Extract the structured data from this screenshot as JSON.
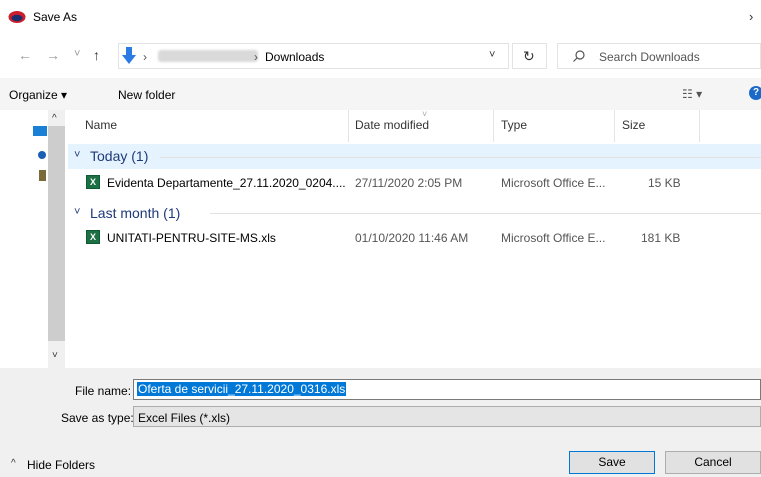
{
  "window": {
    "title": "Save As",
    "close_glyph": "›"
  },
  "address": {
    "back_glyph": "←",
    "forward_glyph": "→",
    "recent_glyph": "˅",
    "up_glyph": "↑",
    "path_sep": "›",
    "path_current": "Downloads",
    "dropdown_glyph": "˅",
    "refresh_glyph": "↻"
  },
  "search": {
    "placeholder": "Search Downloads"
  },
  "toolbar": {
    "organize_label": "Organize ▾",
    "newfolder_label": "New folder",
    "view_glyph": "☷ ▾",
    "help_label": "?"
  },
  "columns": {
    "name": "Name",
    "date": "Date modified",
    "type": "Type",
    "size": "Size"
  },
  "groups": [
    {
      "title": "Today (1)",
      "chevron": "˅",
      "files": [
        {
          "name": "Evidenta Departamente_27.11.2020_0204....",
          "date": "27/11/2020 2:05 PM",
          "type": "Microsoft Office E...",
          "size": "15 KB"
        }
      ]
    },
    {
      "title": "Last month (1)",
      "chevron": "˅",
      "files": [
        {
          "name": "UNITATI-PENTRU-SITE-MS.xls",
          "date": "01/10/2020 11:46 AM",
          "type": "Microsoft Office E...",
          "size": "181 KB"
        }
      ]
    }
  ],
  "form": {
    "filename_label": "File name:",
    "filename_value": "Oferta de servicii_27.11.2020_0316.xls",
    "savetype_label": "Save as type:",
    "savetype_value": "Excel Files (*.xls)"
  },
  "footer": {
    "hide_folders": "Hide Folders",
    "hide_glyph": "^",
    "save_label": "Save",
    "cancel_label": "Cancel"
  },
  "nav": {
    "scroll_up": "^",
    "scroll_down": "˅"
  },
  "colors": {
    "accent": "#0078d7",
    "group_title": "#1e3a78",
    "selection_band": "#e5f3ff"
  }
}
